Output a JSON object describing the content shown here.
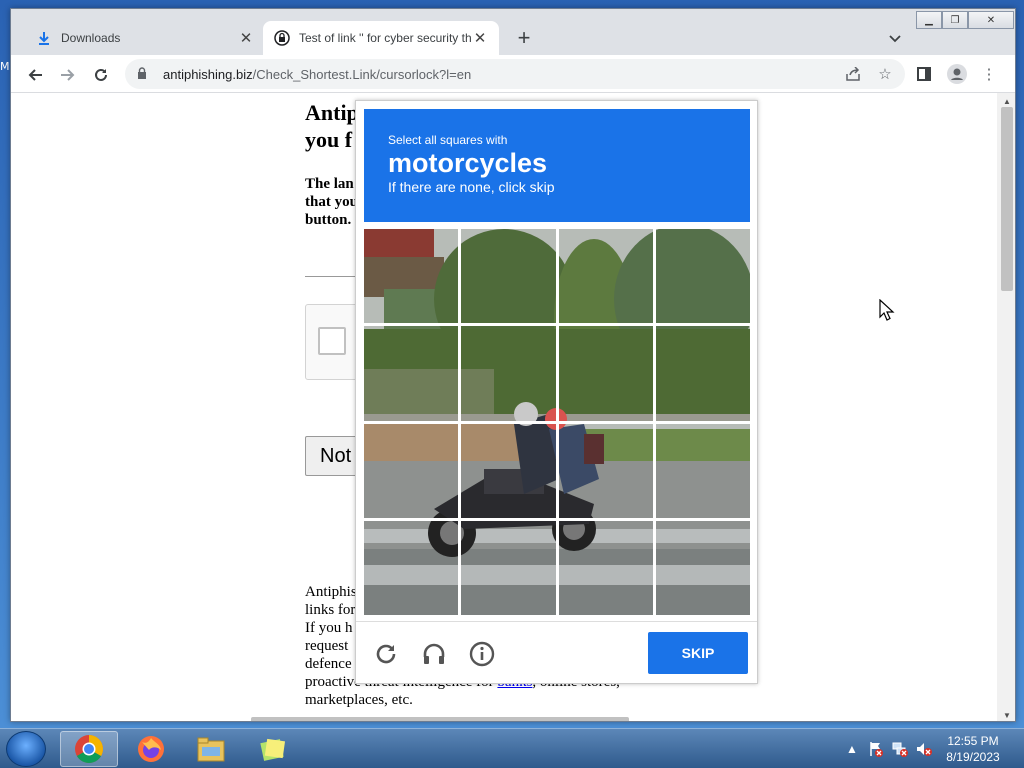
{
  "desktop": {
    "letter": "M"
  },
  "browser": {
    "tabs": [
      {
        "label": "Downloads",
        "icon": "download-icon",
        "active": false
      },
      {
        "label": "Test of link '' for cyber security th",
        "icon": "lock-icon",
        "active": true
      }
    ],
    "address": {
      "domain": "antiphishing.biz",
      "path": "/Check_Shortest.Link/cursorlock?l=en"
    }
  },
  "page": {
    "heading": "Antip\nyou f",
    "subtext": "The lan\nthat you\nbutton.",
    "not_button": "Not",
    "bottom": {
      "line1": "Antiphis",
      "line2": "links for",
      "line3": "If you h",
      "line4": "request ",
      "line5": "defence",
      "line6_prefix": "proactive threat intelligence for ",
      "line6_link": "banks",
      "line6_suffix": ", online stores,",
      "line7": "marketplaces, etc."
    }
  },
  "challenge": {
    "select_text": "Select all squares with",
    "target": "motorcycles",
    "hint": "If there are none, click skip",
    "skip_label": "SKIP",
    "icons": [
      "reload-icon",
      "audio-icon",
      "info-icon"
    ],
    "grid": {
      "rows": 4,
      "cols": 4
    }
  },
  "taskbar": {
    "items": [
      "chrome-icon",
      "firefox-icon",
      "file-explorer-icon",
      "sticky-notes-icon"
    ],
    "clock_time": "12:55 PM",
    "clock_date": "8/19/2023"
  }
}
